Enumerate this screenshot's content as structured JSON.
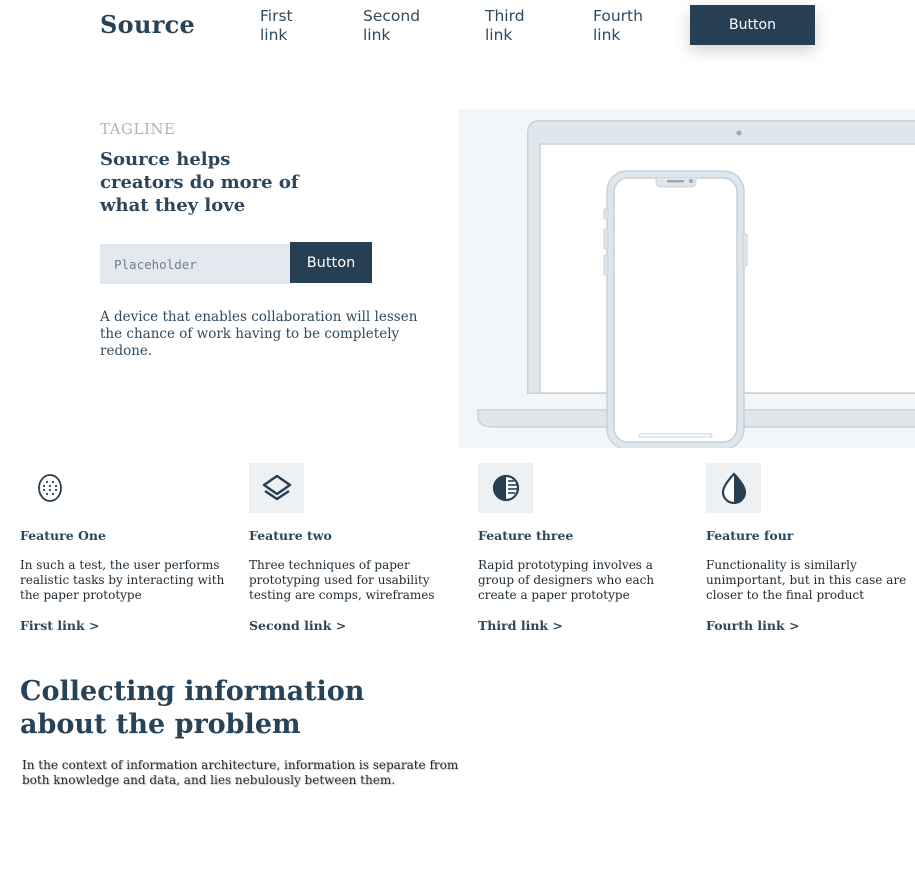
{
  "header": {
    "logo": "Source",
    "links": [
      "First\nlink",
      "Second\nlink",
      "Third\nlink",
      "Fourth\nlink"
    ],
    "button_label": "Button"
  },
  "hero": {
    "tagline": "TAGLINE",
    "title": "Source helps creators do more of what they love",
    "input_placeholder": "Placeholder",
    "button_label": "Button",
    "description": "A device that enables collaboration will lessen the chance of work having to be completely redone."
  },
  "features": [
    {
      "icon": "dotted-circle-icon",
      "title": "Feature One",
      "text": "In such a test, the user performs realistic tasks by interacting with the paper prototype",
      "link": "First link >"
    },
    {
      "icon": "layers-icon",
      "title": "Feature two",
      "text": "Three techniques of paper prototyping used for usability testing are comps, wireframes",
      "link": "Second link >"
    },
    {
      "icon": "striped-circle-icon",
      "title": "Feature three",
      "text": "Rapid prototyping involves a group of designers who each create a paper prototype",
      "link": "Third link >"
    },
    {
      "icon": "contrast-drop-icon",
      "title": "Feature four",
      "text": "Functionality is similarly unimportant, but in this case are closer to the final product",
      "link": "Fourth link >"
    }
  ],
  "info": {
    "title": "Collecting information about the problem",
    "text": "In the context of information architecture, information is separate from both knowledge and data, and lies nebulously between them."
  },
  "colors": {
    "primary": "#263f53",
    "input_bg": "#e3e9ef",
    "illustration_bg": "#f3f6f9",
    "tagline": "#a8b6c2"
  }
}
